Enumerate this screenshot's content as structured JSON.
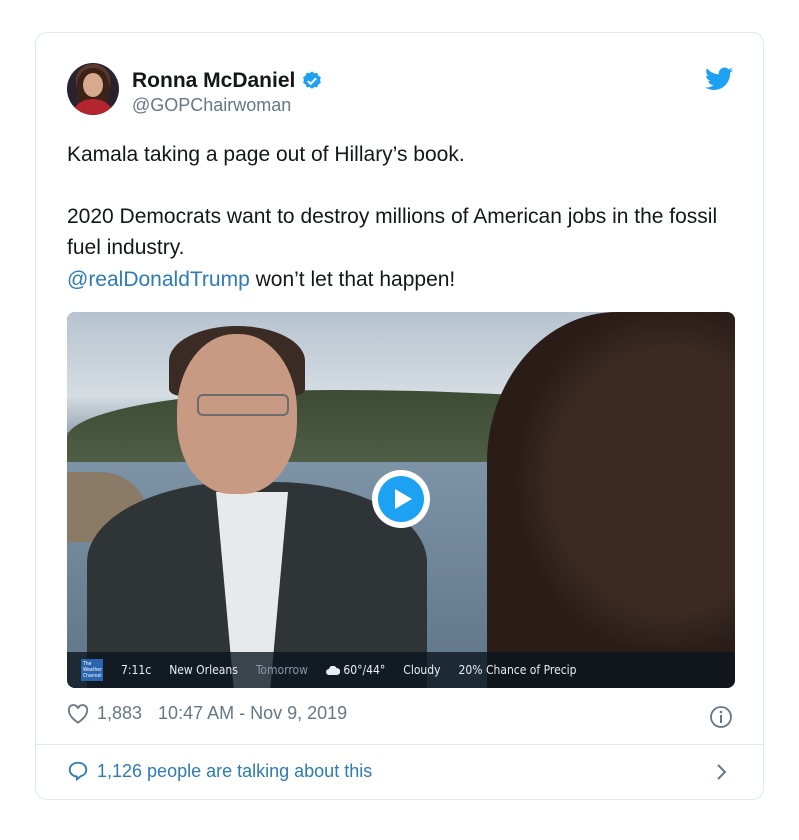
{
  "tweet": {
    "author_name": "Ronna McDaniel",
    "author_handle": "@GOPChairwoman",
    "line1": "Kamala taking a page out of Hillary’s book.",
    "line2": "2020 Democrats want to destroy millions of American jobs in the fossil fuel industry.",
    "mention": "@realDonaldTrump",
    "line3_rest": " won’t let that happen!",
    "likes": "1,883",
    "timestamp": "10:47 AM - Nov 9, 2019",
    "talking": "1,126 people are talking about this"
  },
  "video": {
    "ticker": {
      "brand": "The Weather Channel",
      "time": "7:11c",
      "city": "New Orleans",
      "period": "Tomorrow",
      "temp": "60°/44°",
      "condition": "Cloudy",
      "precip": "20% Chance of Precip"
    }
  },
  "colors": {
    "accent": "#1da1f2",
    "link": "#2b7bb9",
    "muted": "#657786"
  },
  "icons": [
    "verified-badge-icon",
    "twitter-bird-icon",
    "play-icon",
    "heart-icon",
    "info-icon",
    "chat-bubble-icon",
    "chevron-right-icon"
  ]
}
